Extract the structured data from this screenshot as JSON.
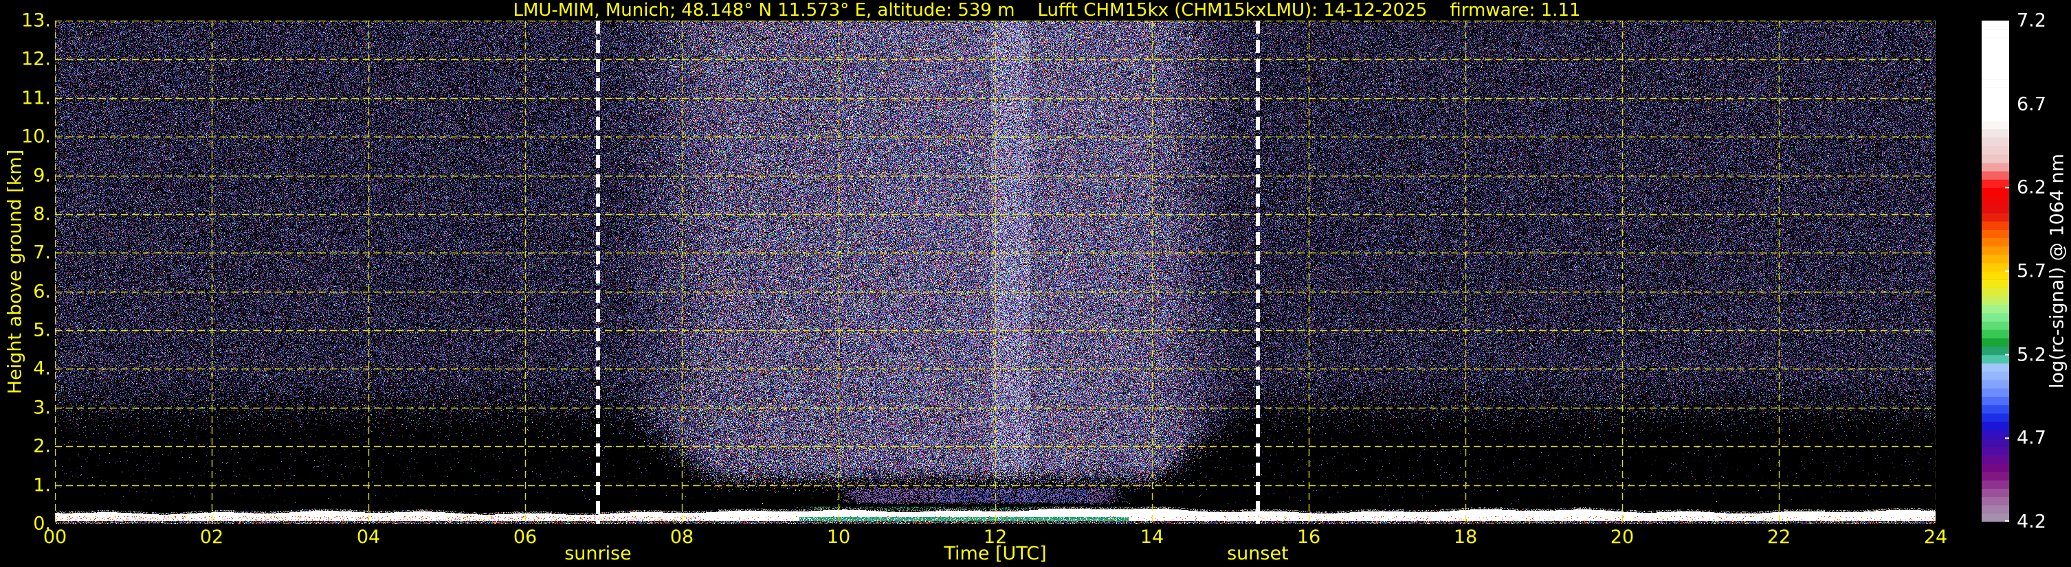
{
  "figure": {
    "background": "#000000",
    "accent_yellow": "#ffff00",
    "label_white": "#ffffff"
  },
  "chart_data": {
    "type": "heatmap",
    "title": "LMU-MIM, Munich; 48.148° N 11.573° E, altitude: 539 m    Lufft CHM15kx (CHM15kxLMU): 14-12-2025    firmware: 1.11",
    "xlabel": "Time [UTC]",
    "ylabel": "Height above ground [km]",
    "x_range_hours": [
      0,
      24
    ],
    "y_range_km": [
      0,
      13
    ],
    "grid": {
      "color": "#e8e800",
      "style": "dashed",
      "x_step_hours": 2,
      "y_step_km": 1
    },
    "x_ticks": [
      {
        "label": "00",
        "hour": 0
      },
      {
        "label": "02",
        "hour": 2
      },
      {
        "label": "04",
        "hour": 4
      },
      {
        "label": "06",
        "hour": 6
      },
      {
        "label": "08",
        "hour": 8
      },
      {
        "label": "10",
        "hour": 10
      },
      {
        "label": "12",
        "hour": 12
      },
      {
        "label": "14",
        "hour": 14
      },
      {
        "label": "16",
        "hour": 16
      },
      {
        "label": "18",
        "hour": 18
      },
      {
        "label": "20",
        "hour": 20
      },
      {
        "label": "22",
        "hour": 22
      },
      {
        "label": "24",
        "hour": 24
      }
    ],
    "y_ticks": [
      {
        "label": "13.",
        "km": 13
      },
      {
        "label": "12.",
        "km": 12
      },
      {
        "label": "11.",
        "km": 11
      },
      {
        "label": "10.",
        "km": 10
      },
      {
        "label": "9.",
        "km": 9
      },
      {
        "label": "8.",
        "km": 8
      },
      {
        "label": "7.",
        "km": 7
      },
      {
        "label": "6.",
        "km": 6
      },
      {
        "label": "5.",
        "km": 5
      },
      {
        "label": "4.",
        "km": 4
      },
      {
        "label": "3.",
        "km": 3
      },
      {
        "label": "2.",
        "km": 2
      },
      {
        "label": "1.",
        "km": 1
      },
      {
        "label": "0.",
        "km": 0
      }
    ],
    "annotations": {
      "sunrise": {
        "label": "sunrise",
        "hour": 6.93,
        "line_color": "#ffffff",
        "line_style": "dashed"
      },
      "sunset": {
        "label": "sunset",
        "hour": 15.35,
        "line_color": "#ffffff",
        "line_style": "dashed"
      }
    },
    "colorbar": {
      "title": "log(rc-signal) @ 1064 nm",
      "range": [
        4.2,
        7.2
      ],
      "ticks": [
        {
          "label": "7.2",
          "value": 7.2
        },
        {
          "label": "6.7",
          "value": 6.7
        },
        {
          "label": "6.2",
          "value": 6.2
        },
        {
          "label": "5.7",
          "value": 5.7
        },
        {
          "label": "5.2",
          "value": 5.2
        },
        {
          "label": "4.7",
          "value": 4.7
        },
        {
          "label": "4.2",
          "value": 4.2
        }
      ],
      "anchors": [
        {
          "v": 4.2,
          "c": "#a899b2"
        },
        {
          "v": 4.28,
          "c": "#a47fab"
        },
        {
          "v": 4.35,
          "c": "#a161a1"
        },
        {
          "v": 4.42,
          "c": "#8f3590"
        },
        {
          "v": 4.5,
          "c": "#7c0a7c"
        },
        {
          "v": 4.6,
          "c": "#5c0c9e"
        },
        {
          "v": 4.7,
          "c": "#390fb4"
        },
        {
          "v": 4.78,
          "c": "#1a17d8"
        },
        {
          "v": 4.85,
          "c": "#1f3cf0"
        },
        {
          "v": 4.95,
          "c": "#5f7fff"
        },
        {
          "v": 5.05,
          "c": "#8fb0ff"
        },
        {
          "v": 5.15,
          "c": "#a8cbf7"
        },
        {
          "v": 5.18,
          "c": "#3cc79c"
        },
        {
          "v": 5.22,
          "c": "#2aa87f"
        },
        {
          "v": 5.25,
          "c": "#128f2a"
        },
        {
          "v": 5.3,
          "c": "#22bb3e"
        },
        {
          "v": 5.35,
          "c": "#4fd66a"
        },
        {
          "v": 5.45,
          "c": "#8df29e"
        },
        {
          "v": 5.5,
          "c": "#b4f37c"
        },
        {
          "v": 5.55,
          "c": "#d5ee4e"
        },
        {
          "v": 5.65,
          "c": "#ffe800"
        },
        {
          "v": 5.75,
          "c": "#ffc300"
        },
        {
          "v": 5.85,
          "c": "#ff8d00"
        },
        {
          "v": 5.95,
          "c": "#ff5500"
        },
        {
          "v": 6.05,
          "c": "#e01010"
        },
        {
          "v": 6.2,
          "c": "#ff0000"
        },
        {
          "v": 6.35,
          "c": "#eec0c0"
        },
        {
          "v": 6.5,
          "c": "#f0dede"
        },
        {
          "v": 6.6,
          "c": "#ffffff"
        },
        {
          "v": 7.2,
          "c": "#ffffff"
        }
      ]
    },
    "features": {
      "surface_layer": {
        "km": [
          0.0,
          0.33
        ],
        "color": "#ffffff",
        "note": "bright white near-ground backscatter band across all 24 h with red/orange specks (strongest 00-08 UTC)"
      },
      "surface_green_layer": {
        "hours": [
          9.3,
          13.9
        ],
        "km": [
          0.08,
          0.18
        ],
        "palette": [
          "#2a9d6f",
          "#36b98a",
          "#1f8f5a",
          "#3fc794",
          "#23825c"
        ]
      },
      "aerosol_layer": {
        "hours": [
          9.9,
          13.75
        ],
        "km": [
          0.48,
          0.97
        ],
        "palette": [
          "#8a5ca8",
          "#9a6cb6",
          "#7a4898",
          "#a678bc",
          "#6a5cc0",
          "#555fd6"
        ],
        "bright_patch_hours": [
          11.3,
          13.2
        ],
        "bright_palette": [
          "#2255ff",
          "#4488ff",
          "#3366ff"
        ]
      },
      "noise": {
        "night_purples": [
          "#2a1a52",
          "#332064",
          "#3d2878",
          "#49318f",
          "#55399f",
          "#3a2f7e",
          "#241544",
          "#6a4aa8",
          "#8360b8",
          "#1c123a",
          "#8a63c4",
          "#4b2570"
        ],
        "night_accents": [
          "#2e55cc",
          "#4466dd",
          "#7788ee",
          "#a08cc8",
          "#c24444",
          "#33aa66",
          "#22bbcc",
          "#d0c8e8",
          "#b05890"
        ],
        "day_vivid": [
          "#3355ee",
          "#4477ff",
          "#66aaff",
          "#88ccff",
          "#ffffff",
          "#ff4444",
          "#ff8833",
          "#ffee44",
          "#33cc66",
          "#33ddcc",
          "#cc55cc",
          "#ff66aa",
          "#aaddff",
          "#e0e6ff"
        ],
        "surface_bottom_specks": [
          "#000000",
          "#000000",
          "#000000",
          "#000000",
          "#000000",
          "#cc2222",
          "#cc2222",
          "#2233cc",
          "#2233cc",
          "#22aa44",
          "#ffffff",
          "#ff8822",
          "#22aacc"
        ],
        "ragged_grays": [
          "#aaaaaa",
          "#888888",
          "#cccccc",
          "#666666"
        ],
        "ragged_colors": [
          "#cc2222",
          "#2233cc",
          "#22aa44",
          "#ff8822"
        ],
        "red_speck_color": "#e04818"
      }
    }
  }
}
